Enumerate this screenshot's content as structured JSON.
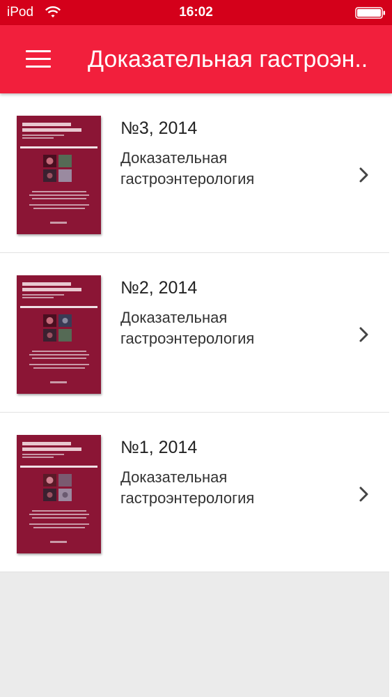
{
  "status_bar": {
    "carrier": "iPod",
    "time": "16:02"
  },
  "app_bar": {
    "title": "Доказательная гастроэн..",
    "menu_icon": "hamburger-icon"
  },
  "issues": [
    {
      "title": "№3, 2014",
      "journal": "Доказательная гастроэнтерология"
    },
    {
      "title": "№2, 2014",
      "journal": "Доказательная гастроэнтерология"
    },
    {
      "title": "№1, 2014",
      "journal": "Доказательная гастроэнтерология"
    }
  ],
  "colors": {
    "status_bar": "#d4001a",
    "app_bar": "#f21f3c",
    "cover": "#8b1535"
  }
}
